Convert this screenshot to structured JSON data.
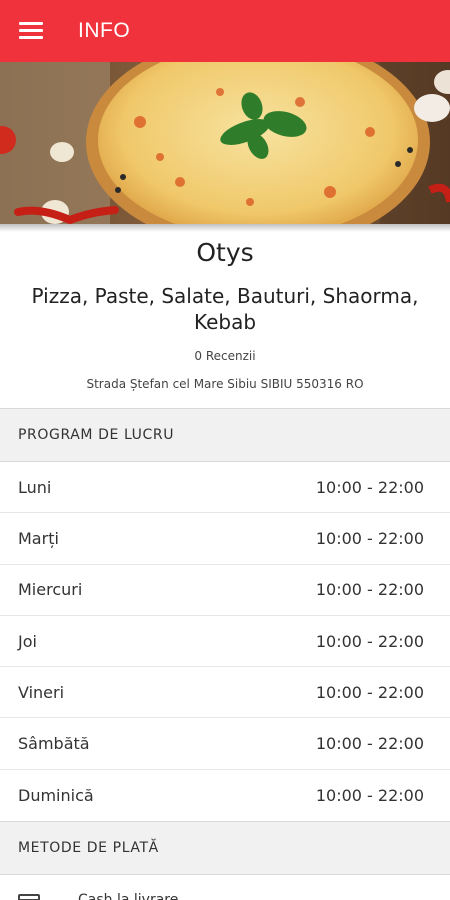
{
  "appbar": {
    "title": "INFO",
    "menu_icon": "hamburger-menu-icon",
    "color": "#f0323d"
  },
  "restaurant": {
    "name": "Otys",
    "cuisine": "Pizza, Paste, Salate, Bauturi, Shaorma, Kebab",
    "reviews": "0 Recenzii",
    "address": "Strada Ștefan cel Mare Sibiu SIBIU 550316 RO"
  },
  "schedule": {
    "header": "PROGRAM DE LUCRU",
    "days": [
      {
        "day": "Luni",
        "hours": "10:00 - 22:00"
      },
      {
        "day": "Marți",
        "hours": "10:00 - 22:00"
      },
      {
        "day": "Miercuri",
        "hours": "10:00 - 22:00"
      },
      {
        "day": "Joi",
        "hours": "10:00 - 22:00"
      },
      {
        "day": "Vineri",
        "hours": "10:00 - 22:00"
      },
      {
        "day": "Sâmbătă",
        "hours": "10:00 - 22:00"
      },
      {
        "day": "Duminică",
        "hours": "10:00 - 22:00"
      }
    ]
  },
  "payment": {
    "header": "METODE DE PLATĂ",
    "methods": [
      {
        "label": "Cash la livrare",
        "icon": "credit-card-icon"
      }
    ]
  }
}
